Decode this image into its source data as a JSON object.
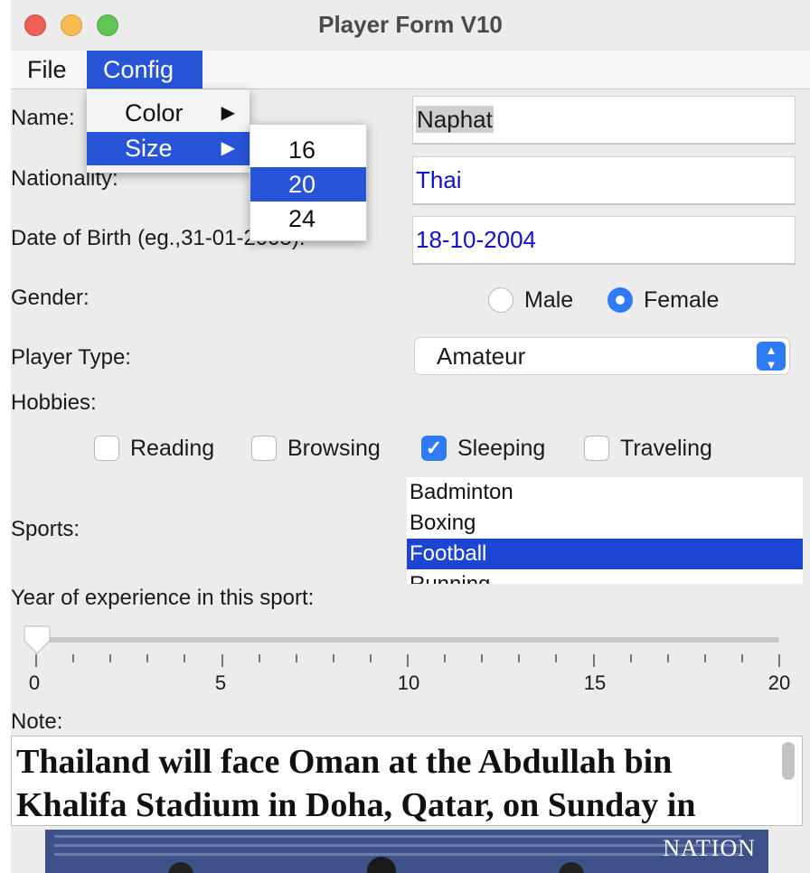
{
  "window": {
    "title": "Player Form V10"
  },
  "menubar": {
    "file": "File",
    "config": "Config"
  },
  "config_menu": {
    "items": [
      {
        "label": "Color"
      },
      {
        "label": "Size"
      }
    ],
    "arrow": "▶",
    "size_submenu": [
      "16",
      "20",
      "24"
    ],
    "selected_size": "20"
  },
  "form": {
    "name_label": "Name:",
    "name_value": "Naphat",
    "nationality_label": "Nationality:",
    "nationality_value": "Thai",
    "dob_label": "Date of Birth (eg.,31-01-2005):",
    "dob_value": "18-10-2004",
    "gender_label": "Gender:",
    "gender_male": "Male",
    "gender_female": "Female",
    "gender_selected": "Female",
    "player_type_label": "Player Type:",
    "player_type_value": "Amateur",
    "hobbies_label": "Hobbies:",
    "hobbies": [
      {
        "label": "Reading",
        "checked": false
      },
      {
        "label": "Browsing",
        "checked": false
      },
      {
        "label": "Sleeping",
        "checked": true
      },
      {
        "label": "Traveling",
        "checked": false
      }
    ],
    "sports_label": "Sports:",
    "sports": [
      "Badminton",
      "Boxing",
      "Football",
      "Running"
    ],
    "sports_selected": "Football",
    "experience_label": "Year of experience in this sport:",
    "experience": {
      "min": 0,
      "max": 20,
      "value": 0,
      "labels": [
        "0",
        "5",
        "10",
        "15",
        "20"
      ]
    },
    "note_label": "Note:",
    "note_text": "Thailand will face Oman at the Abdullah bin Khalifa Stadium in Doha, Qatar, on Sunday in",
    "image_logo": "NATION"
  },
  "colors": {
    "accent": "#2855d8",
    "selection": "#1d45d4",
    "input_text_blue": "#1010d0"
  }
}
